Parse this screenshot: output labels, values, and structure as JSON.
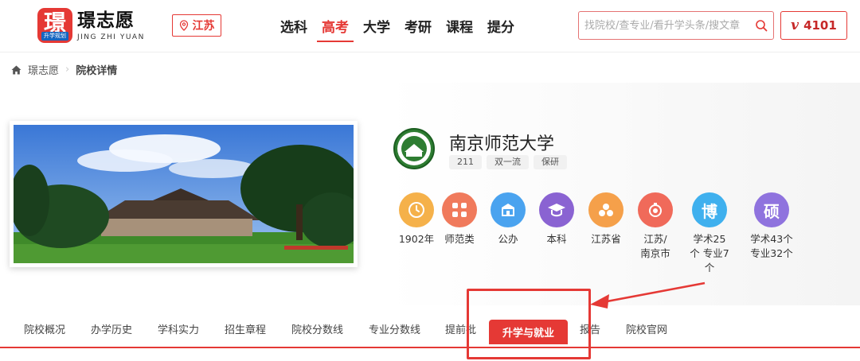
{
  "header": {
    "logo": {
      "mark": "璟",
      "tag": "升学规划",
      "name": "璟志愿",
      "name_en": "JING ZHI YUAN"
    },
    "region": "江苏",
    "nav": [
      {
        "label": "选科",
        "active": false
      },
      {
        "label": "高考",
        "active": true
      },
      {
        "label": "大学",
        "active": false
      },
      {
        "label": "考研",
        "active": false
      },
      {
        "label": "课程",
        "active": false
      },
      {
        "label": "提分",
        "active": false
      }
    ],
    "search_placeholder": "找院校/查专业/看升学头条/搜文章",
    "vip": {
      "icon": "v",
      "count": "4101"
    }
  },
  "breadcrumb": {
    "home": "璟志愿",
    "current": "院校详情"
  },
  "university": {
    "name": "南京师范大学",
    "tags": [
      "211",
      "双一流",
      "保研"
    ],
    "facts": [
      {
        "icon": "clock-icon",
        "label": "1902年",
        "color": "#f5b14a"
      },
      {
        "icon": "grid-icon",
        "label": "师范类",
        "color": "#f07a5c"
      },
      {
        "icon": "building-icon",
        "label": "公办",
        "color": "#4aa3ef"
      },
      {
        "icon": "graduation-cap-icon",
        "label": "本科",
        "color": "#8a63d2"
      },
      {
        "icon": "province-icon",
        "label": "江苏省",
        "color": "#f5a04a"
      },
      {
        "icon": "city-icon",
        "label": "江苏/南京市",
        "color": "#f06a5a"
      },
      {
        "icon": "bo-icon",
        "glyph": "博",
        "label": "学术25个 专业7个",
        "color": "#3fb0ee"
      },
      {
        "icon": "shuo-icon",
        "glyph": "硕",
        "label": "学术43个 专业32个",
        "color": "#8f73de"
      }
    ]
  },
  "tabs": [
    {
      "label": "院校概况",
      "active": false
    },
    {
      "label": "办学历史",
      "active": false
    },
    {
      "label": "学科实力",
      "active": false
    },
    {
      "label": "招生章程",
      "active": false
    },
    {
      "label": "院校分数线",
      "active": false
    },
    {
      "label": "专业分数线",
      "active": false
    },
    {
      "label": "提前批",
      "active": false
    },
    {
      "label": "升学与就业",
      "active": true
    },
    {
      "label": "报告",
      "active": false
    },
    {
      "label": "院校官网",
      "active": false
    }
  ],
  "colors": {
    "accent": "#e53935"
  }
}
